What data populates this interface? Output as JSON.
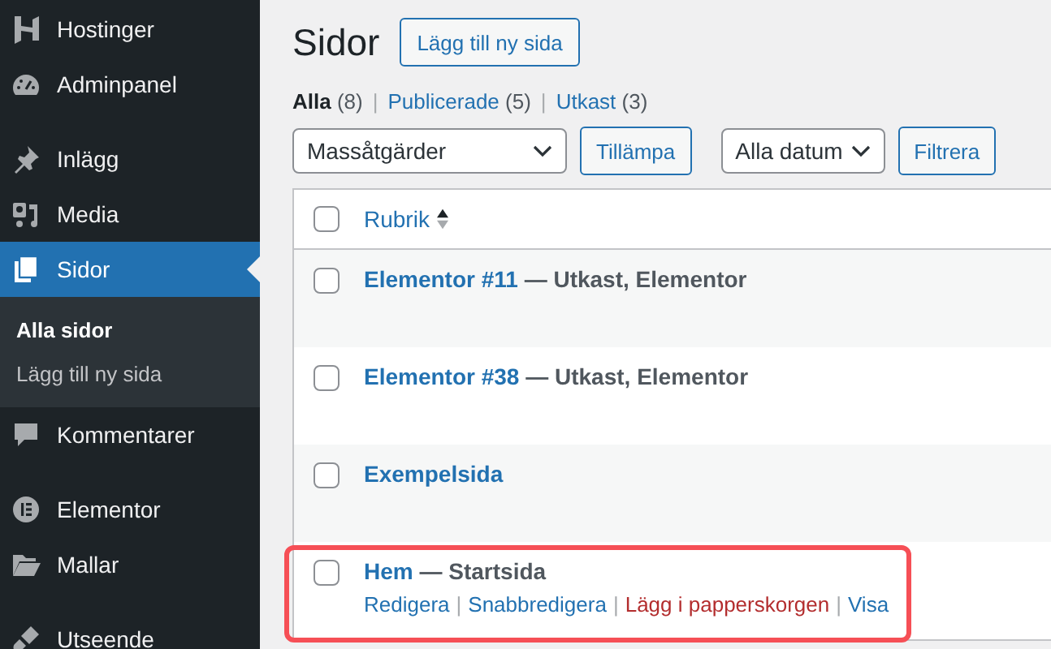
{
  "sidebar": {
    "groups": [
      [
        {
          "label": "Hostinger",
          "selected": false
        },
        {
          "label": "Adminpanel",
          "selected": false
        }
      ],
      [
        {
          "label": "Inlägg",
          "selected": false
        },
        {
          "label": "Media",
          "selected": false
        },
        {
          "label": "Sidor",
          "selected": true,
          "children": [
            {
              "label": "Alla sidor",
              "selected": true
            },
            {
              "label": "Lägg till ny sida",
              "selected": false
            }
          ]
        },
        {
          "label": "Kommentarer",
          "selected": false
        }
      ],
      [
        {
          "label": "Elementor",
          "selected": false
        },
        {
          "label": "Mallar",
          "selected": false
        }
      ],
      [
        {
          "label": "Utseende",
          "selected": false
        }
      ]
    ]
  },
  "page": {
    "title": "Sidor",
    "add_button": "Lägg till ny sida"
  },
  "filters": [
    {
      "label": "Alla",
      "count": "(8)",
      "selected": true
    },
    {
      "separator_before": "|",
      "label": "Publicerade",
      "count": "(5)",
      "selected": false
    },
    {
      "separator_before": "|",
      "label": "Utkast",
      "count": "(3)",
      "selected": false
    }
  ],
  "toolbar": {
    "bulk_select": "Massåtgärder",
    "apply_button": "Tillämpa",
    "date_select": "Alla datum",
    "filter_button": "Filtrera"
  },
  "table": {
    "column_header": "Rubrik",
    "header_checked": false,
    "rows": [
      {
        "title": "Elementor #11",
        "state": " — Utkast, Elementor",
        "checked": false,
        "highlighted": false
      },
      {
        "title": "Elementor #38",
        "state": " — Utkast, Elementor",
        "checked": false,
        "highlighted": false
      },
      {
        "title": "Exempelsida",
        "checked": false,
        "highlighted": false
      },
      {
        "title": "Hem",
        "state": " — Startsida",
        "checked": false,
        "highlighted": true,
        "actions": [
          {
            "label": "Redigera",
            "kind": "link"
          },
          {
            "separator_before": "|",
            "label": "Snabbredigera",
            "kind": "link"
          },
          {
            "separator_before": "|",
            "label": "Lägg i papperskorgen",
            "kind": "delete"
          },
          {
            "separator_before": "|",
            "label": "Visa",
            "kind": "link"
          }
        ]
      }
    ]
  }
}
